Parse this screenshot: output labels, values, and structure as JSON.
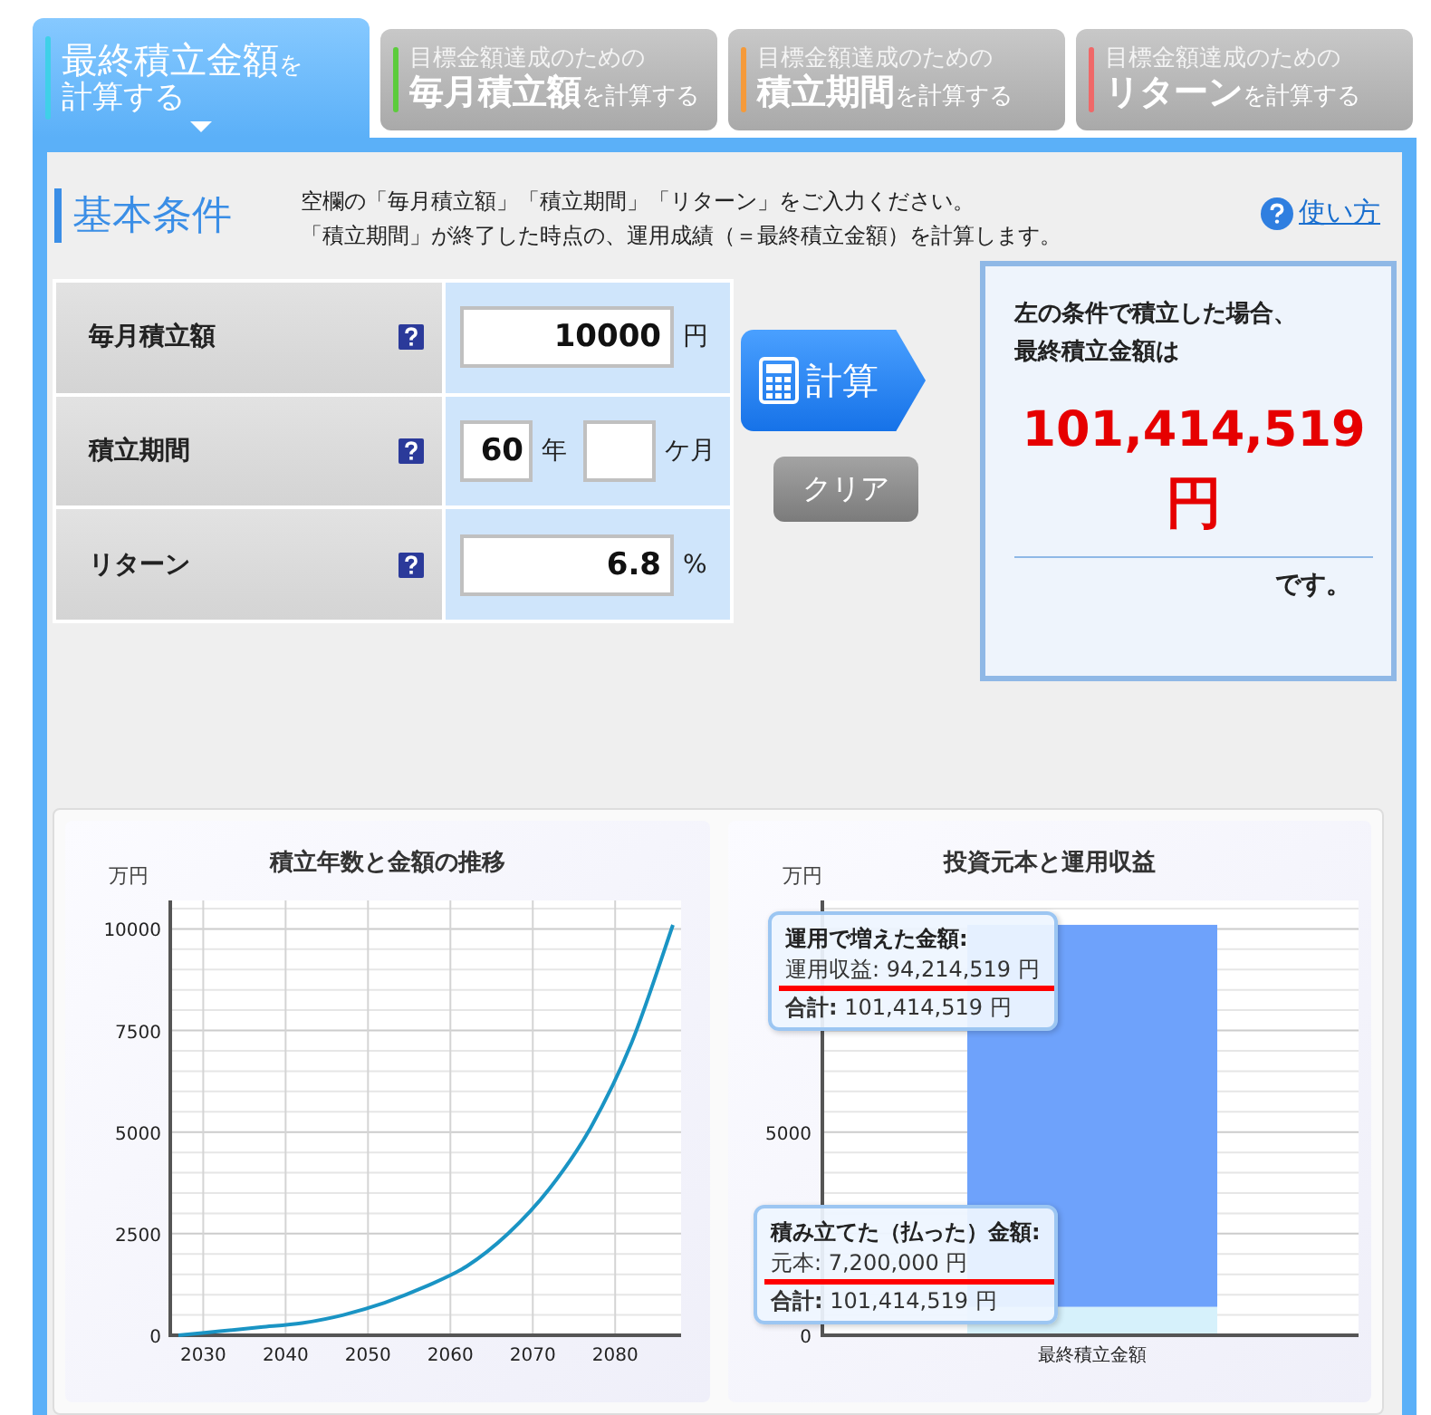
{
  "tabs": [
    {
      "title": "最終積立金額",
      "suffix": "を",
      "subtitle": "計算する",
      "color": "#3fd0e8",
      "selected": true
    },
    {
      "caption": "目標金額達成のための",
      "title": "毎月積立額",
      "suffix": "を計算する",
      "color": "#5ccc3c",
      "selected": false
    },
    {
      "caption": "目標金額達成のための",
      "title": "積立期間",
      "suffix": "を計算する",
      "color": "#f59a3a",
      "selected": false
    },
    {
      "caption": "目標金額達成のための",
      "title": "リターン",
      "suffix": "を計算する",
      "color": "#f06868",
      "selected": false
    }
  ],
  "panel": {
    "heading": "基本条件",
    "description": [
      "空欄の「毎月積立額」「積立期間」「リターン」をご入力ください。",
      "「積立期間」が終了した時点の、運用成績（＝最終積立金額）を計算します。"
    ],
    "help_link": "使い方"
  },
  "form": {
    "rows": [
      {
        "label": "毎月積立額",
        "inputs": [
          {
            "value": "10000",
            "unit": "円"
          }
        ]
      },
      {
        "label": "積立期間",
        "inputs": [
          {
            "value": "60",
            "unit": "年"
          },
          {
            "unit": "ケ月"
          }
        ]
      },
      {
        "label": "リターン",
        "inputs": [
          {
            "value": "6.8",
            "unit": "%"
          }
        ]
      }
    ]
  },
  "buttons": {
    "calculate": "計算",
    "clear": "クリア"
  },
  "result": {
    "lines": [
      "左の条件で積立した場合、",
      "最終積立金額は"
    ],
    "amount": "101,414,519",
    "unit": "円",
    "closing": "です。"
  },
  "charts": [
    {
      "title": "積立年数と金額の推移",
      "chart_data": {
        "type": "line",
        "ylabel": "万円",
        "x": [
          2027,
          2032,
          2037,
          2042,
          2047,
          2052,
          2057,
          2062,
          2067,
          2072,
          2077,
          2082,
          2087
        ],
        "series": [
          {
            "color": "#1a94c4",
            "values": [
              0,
              100,
              200,
              300,
              500,
              800,
              1200,
              1700,
              2500,
              3600,
              5100,
              7200,
              10100
            ]
          }
        ],
        "xlim": [
          2026,
          2088
        ],
        "ylim": [
          0,
          10700
        ],
        "xticks": [
          2030,
          2040,
          2050,
          2060,
          2070,
          2080
        ],
        "yticks": [
          0,
          2500,
          5000,
          7500,
          10000
        ],
        "grid": true
      }
    },
    {
      "title": "投資元本と運用収益",
      "chart_data": {
        "type": "bar",
        "ylabel": "万円",
        "categories": [
          "最終積立金額"
        ],
        "series": [
          {
            "color": "#d6f1fb",
            "values": [
              700
            ]
          },
          {
            "color": "#6ea2fb",
            "values": [
              9400
            ]
          }
        ],
        "stacked": true,
        "ylim": [
          0,
          10700
        ],
        "yticks": [
          0,
          5000
        ],
        "grid": true
      },
      "tooltips": [
        {
          "title": "運用で増えた金額:",
          "lines": [
            {
              "text": "運用収益: 94,214,519 円",
              "highlighted": true
            },
            {
              "text": "**合計:** 101,414,519 円",
              "highlighted": false
            }
          ]
        },
        {
          "title": "積み立てた（払った）金額:",
          "lines": [
            {
              "text": "元本: 7,200,000 円",
              "highlighted": true
            },
            {
              "text": "**合計:** 101,414,519 円",
              "highlighted": false
            }
          ]
        }
      ]
    }
  ]
}
